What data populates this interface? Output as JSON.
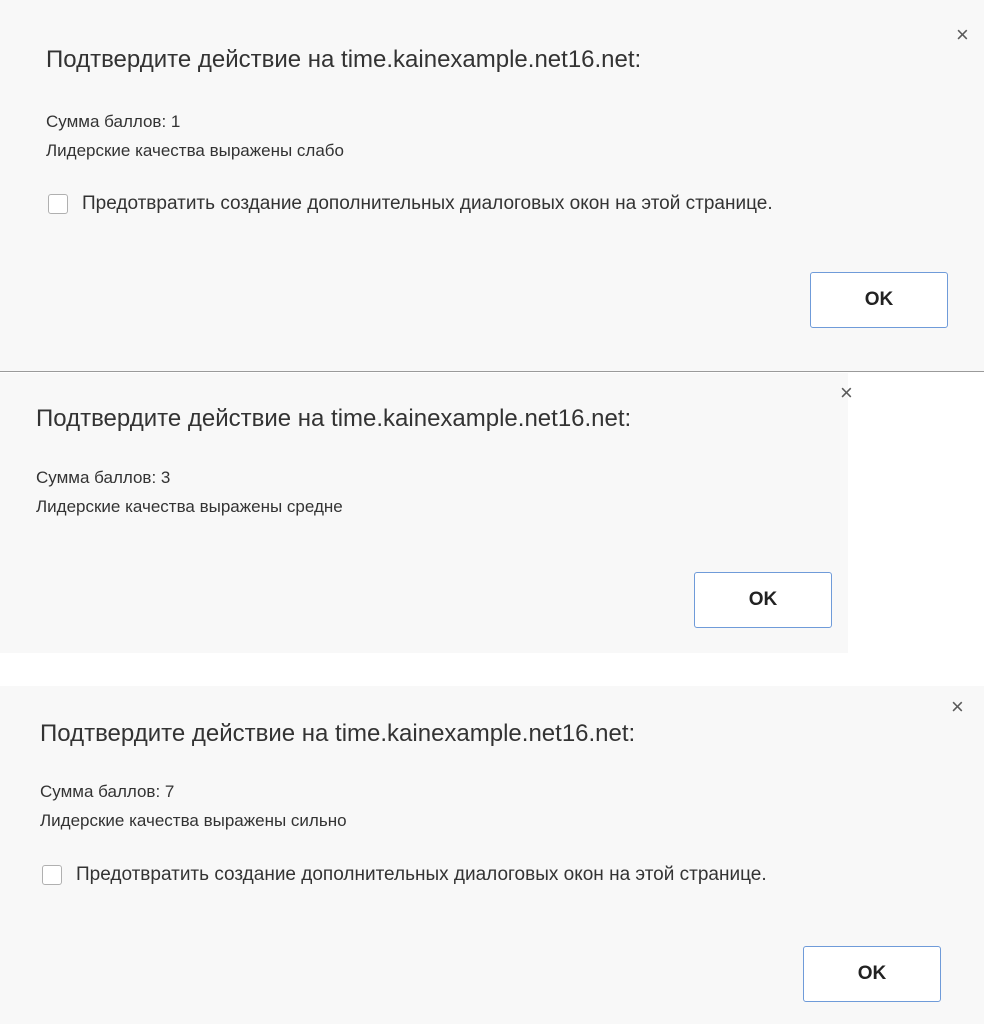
{
  "dialogs": [
    {
      "title": "Подтвердите действие на time.kainexample.net16.net:",
      "score": "Сумма баллов: 1",
      "result": "Лидерские качества выражены слабо",
      "checkbox_label": "Предотвратить создание дополнительных диалоговых окон на этой странице.",
      "ok_label": "OK",
      "close_glyph": "×"
    },
    {
      "title": "Подтвердите действие на time.kainexample.net16.net:",
      "score": "Сумма баллов: 3",
      "result": "Лидерские качества выражены средне",
      "ok_label": "OK",
      "close_glyph": "×"
    },
    {
      "title": "Подтвердите действие на time.kainexample.net16.net:",
      "score": "Сумма баллов: 7",
      "result": "Лидерские качества выражены сильно",
      "checkbox_label": "Предотвратить создание дополнительных диалоговых окон на этой странице.",
      "ok_label": "OK",
      "close_glyph": "×"
    }
  ],
  "colors": {
    "dialog_background": "#f8f8f8",
    "button_border": "#6f9bd9",
    "text": "#333333"
  },
  "icons": [
    "close-icon",
    "checkbox-icon"
  ]
}
